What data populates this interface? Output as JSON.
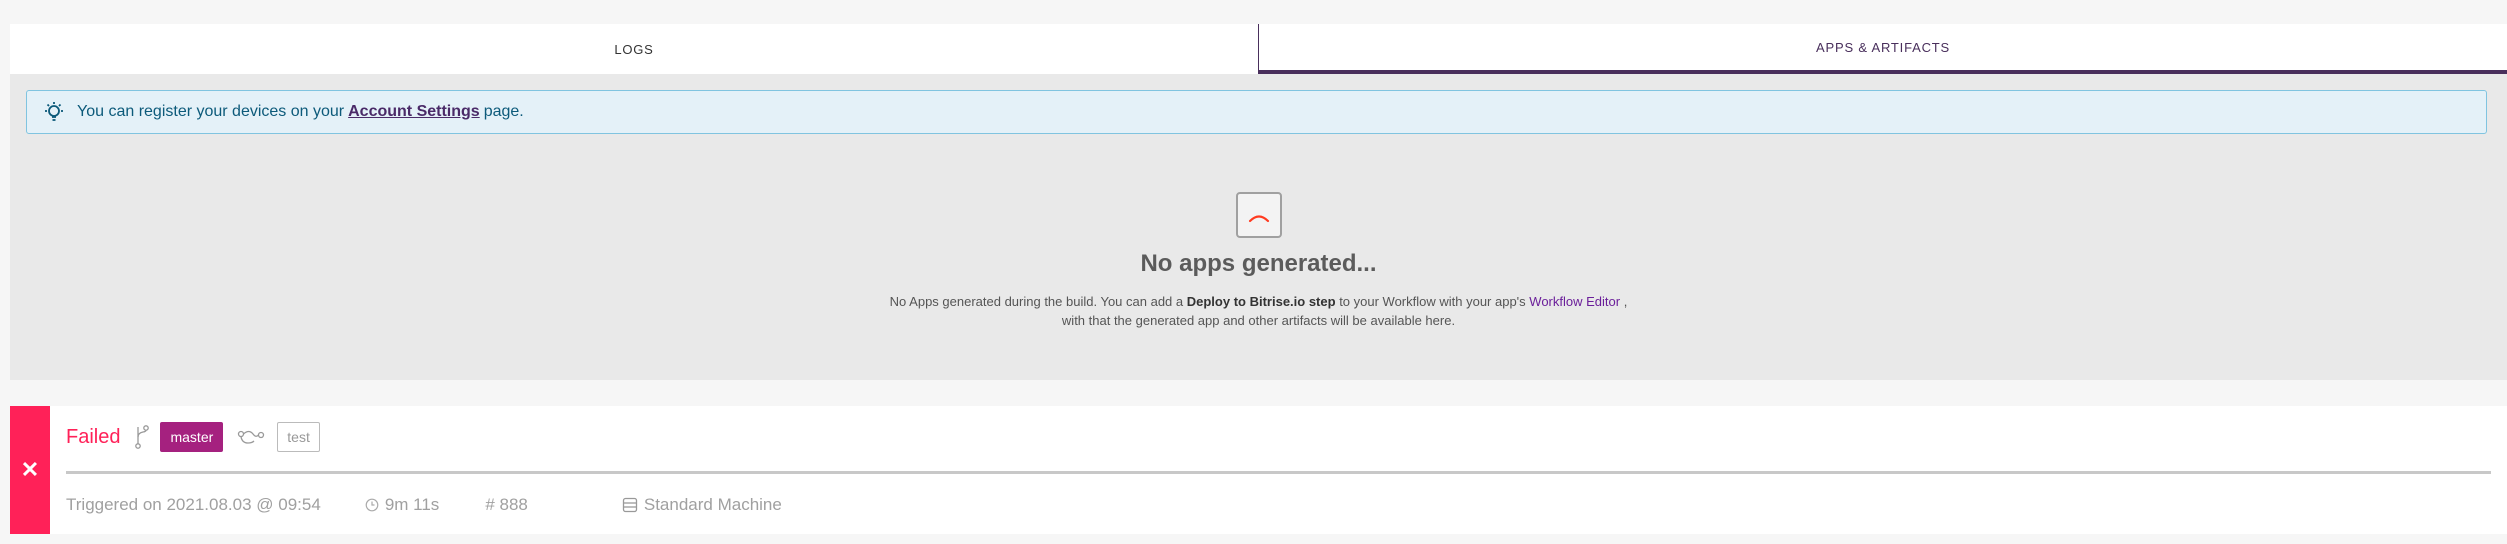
{
  "tabs": [
    {
      "label": "LOGS",
      "active": false
    },
    {
      "label": "APPS & ARTIFACTS",
      "active": true
    }
  ],
  "info_banner": {
    "icon": "lightbulb-icon",
    "text_before": "You can register your devices on your",
    "link_text": "Account Settings",
    "text_after": "page."
  },
  "empty_state": {
    "icon": "sad-face-icon",
    "title": "No apps generated...",
    "desc_1": "No Apps generated during the build. You can add a",
    "desc_bold": "Deploy to Bitrise.io step",
    "desc_2": "to your Workflow with your app's",
    "desc_link": "Workflow Editor",
    "desc_3": ",",
    "desc_line2": "with that the generated app and other artifacts will be available here."
  },
  "build": {
    "status_icon": "close-icon",
    "status_glyph": "✕",
    "status": "Failed",
    "branch": "master",
    "workflow": "test",
    "triggered": "Triggered on 2021.08.03 @ 09:54",
    "duration": "9m 11s",
    "number": "# 888",
    "machine": "Standard Machine"
  },
  "colors": {
    "accent": "#492f5c",
    "failed": "#ff2158",
    "branch": "#a5217f",
    "info_bg": "#e4f1f8"
  }
}
